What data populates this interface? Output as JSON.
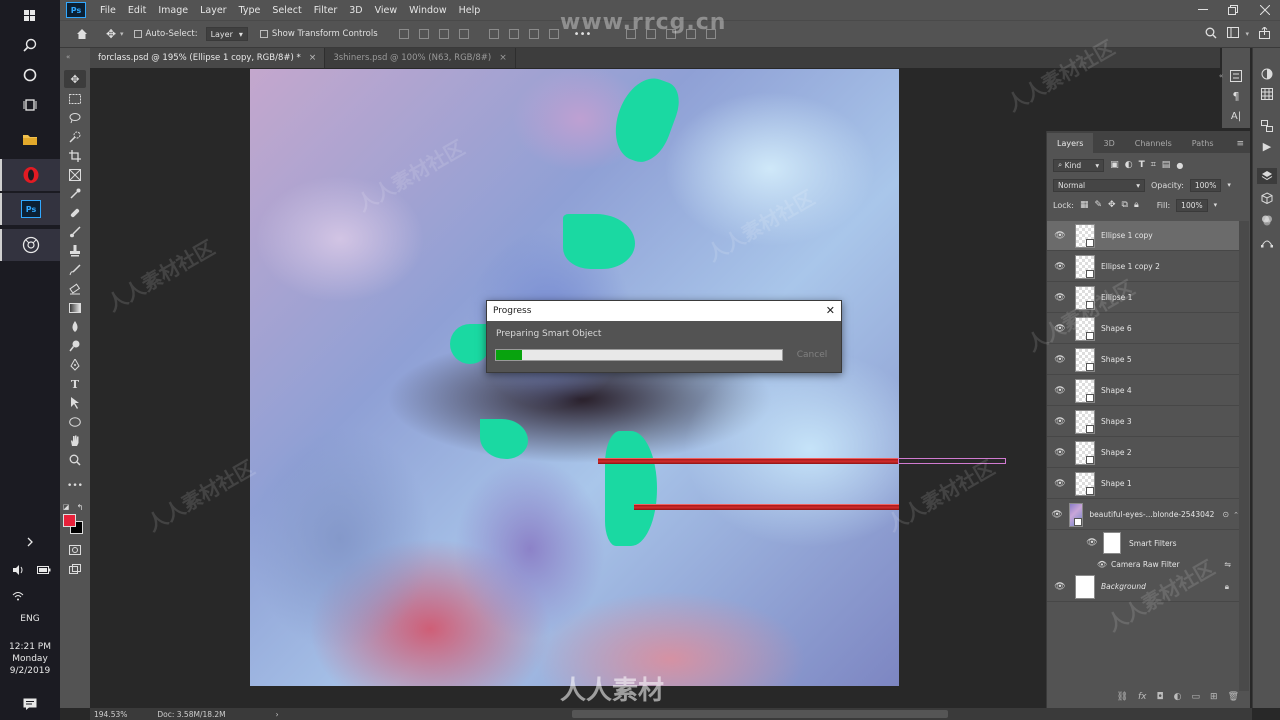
{
  "taskbar": {
    "icons": [
      "windows-start-icon",
      "search-icon",
      "cortana-icon",
      "task-view-icon",
      "file-explorer-icon",
      "opera-icon",
      "photoshop-icon",
      "camera-icon"
    ],
    "ps_label": "Ps",
    "lang": "ENG",
    "time": "12:21 PM",
    "day": "Monday",
    "date": "9/2/2019"
  },
  "menubar": {
    "logo": "Ps",
    "items": [
      "File",
      "Edit",
      "Image",
      "Layer",
      "Type",
      "Select",
      "Filter",
      "3D",
      "View",
      "Window",
      "Help"
    ]
  },
  "options": {
    "auto_select_label": "Auto-Select:",
    "auto_select_value": "Layer",
    "transform_label": "Show Transform Controls"
  },
  "tabs": [
    {
      "label": "forclass.psd @ 195% (Ellipse 1 copy, RGB/8#) *",
      "active": true
    },
    {
      "label": "3shiners.psd @ 100% (N63, RGB/8#)",
      "active": false
    }
  ],
  "dialog": {
    "title": "Progress",
    "message": "Preparing Smart Object",
    "progress": 0.09,
    "cancel": "Cancel"
  },
  "layers_panel": {
    "tabs": [
      "Layers",
      "3D",
      "Channels",
      "Paths"
    ],
    "kind_label": "Kind",
    "blend_mode": "Normal",
    "opacity_label": "Opacity:",
    "opacity_value": "100%",
    "lock_label": "Lock:",
    "fill_label": "Fill:",
    "fill_value": "100%",
    "layers": [
      {
        "name": "Ellipse 1 copy",
        "selected": true
      },
      {
        "name": "Ellipse 1 copy 2",
        "selected": false
      },
      {
        "name": "Ellipse 1",
        "selected": false
      },
      {
        "name": "Shape 6",
        "selected": false
      },
      {
        "name": "Shape 5",
        "selected": false
      },
      {
        "name": "Shape 4",
        "selected": false
      },
      {
        "name": "Shape 3",
        "selected": false
      },
      {
        "name": "Shape 2",
        "selected": false
      },
      {
        "name": "Shape 1",
        "selected": false
      },
      {
        "name": "beautiful-eyes-...blonde-2543042",
        "selected": false
      }
    ],
    "smart_filters": "Smart Filters",
    "camera_raw": "Camera Raw Filter",
    "background": "Background"
  },
  "status": {
    "zoom": "194.53%",
    "doc": "Doc: 3.58M/18.2M"
  },
  "watermark": {
    "top": "www.rrcg.cn",
    "bottom": "人人素材",
    "repeat": "人人素材社区"
  },
  "colors": {
    "foreground": "#e8213a",
    "background": "#000000",
    "progress_fill": "#08a30e",
    "accent_green": "#1ad9a2"
  }
}
